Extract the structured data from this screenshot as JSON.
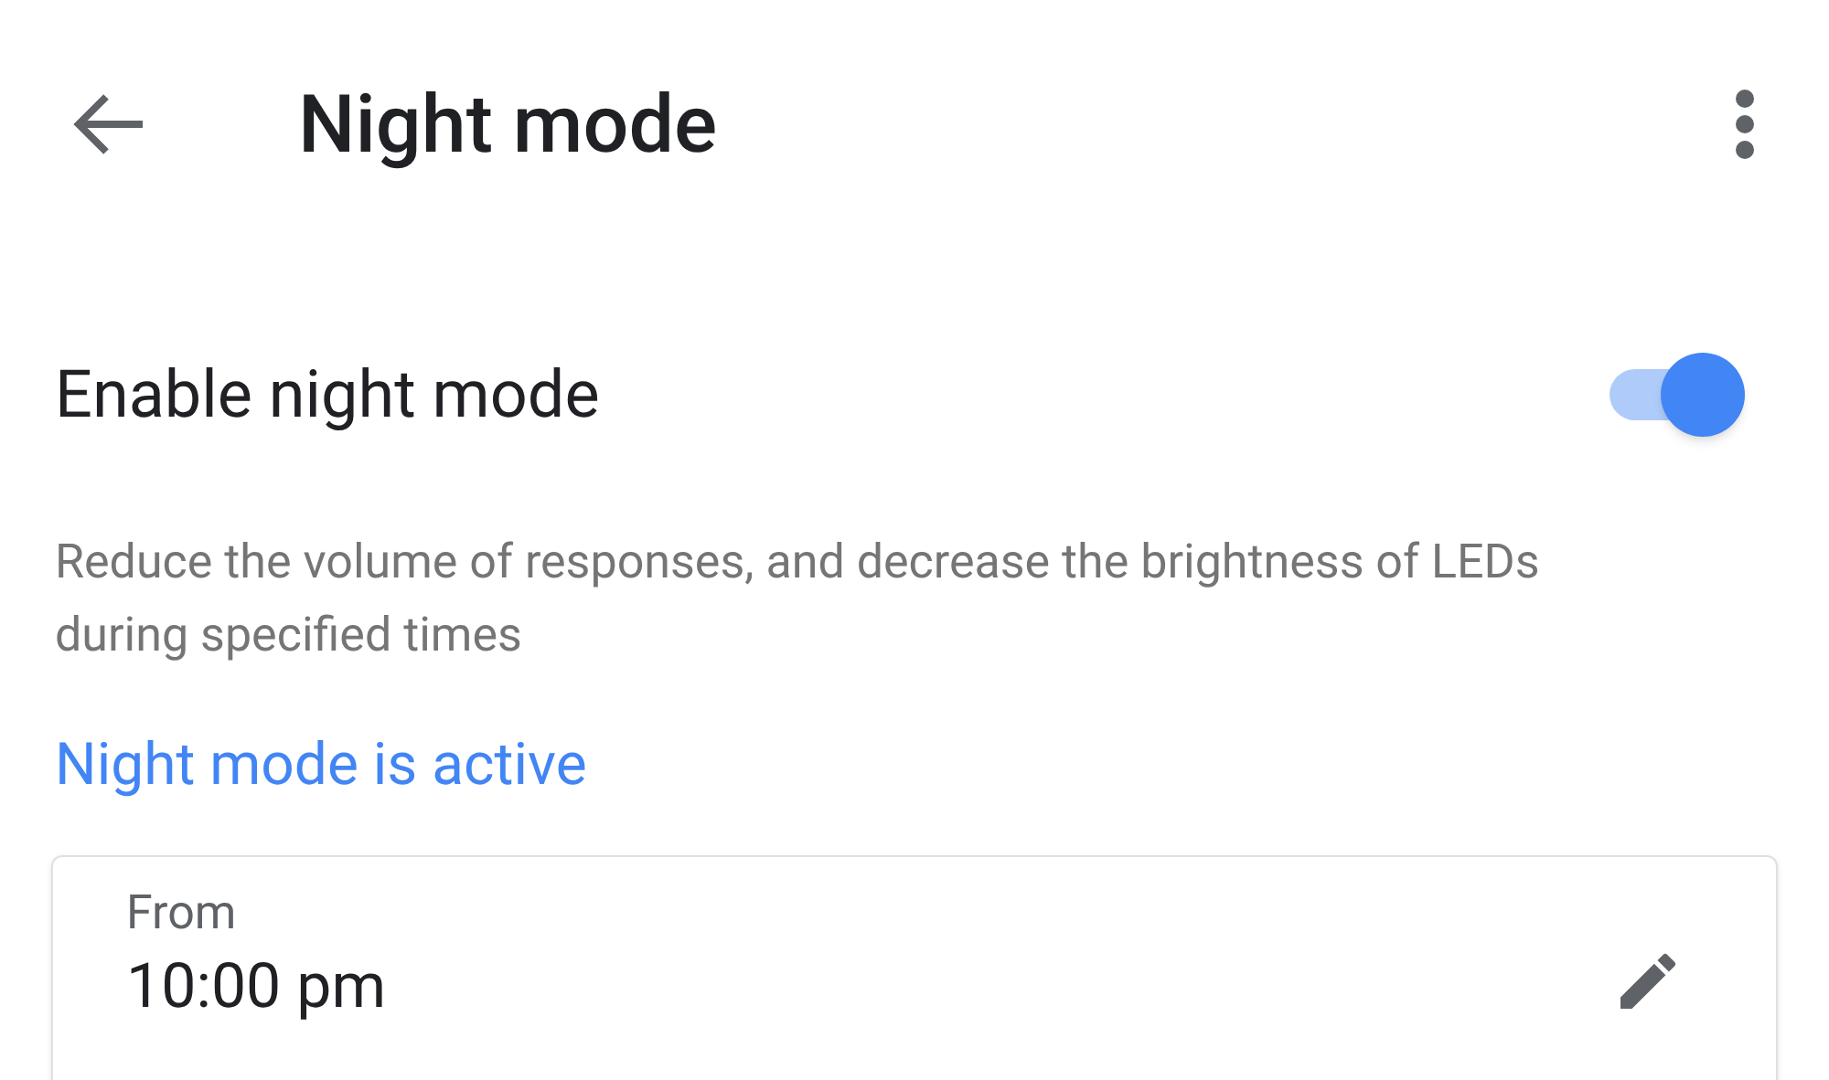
{
  "header": {
    "title": "Night mode"
  },
  "setting": {
    "label": "Enable night mode",
    "on": true,
    "description": "Reduce the volume of responses, and decrease the brightness of LEDs during specified times"
  },
  "status": "Night mode is active",
  "schedule": {
    "label": "From",
    "time": "10:00 pm"
  }
}
